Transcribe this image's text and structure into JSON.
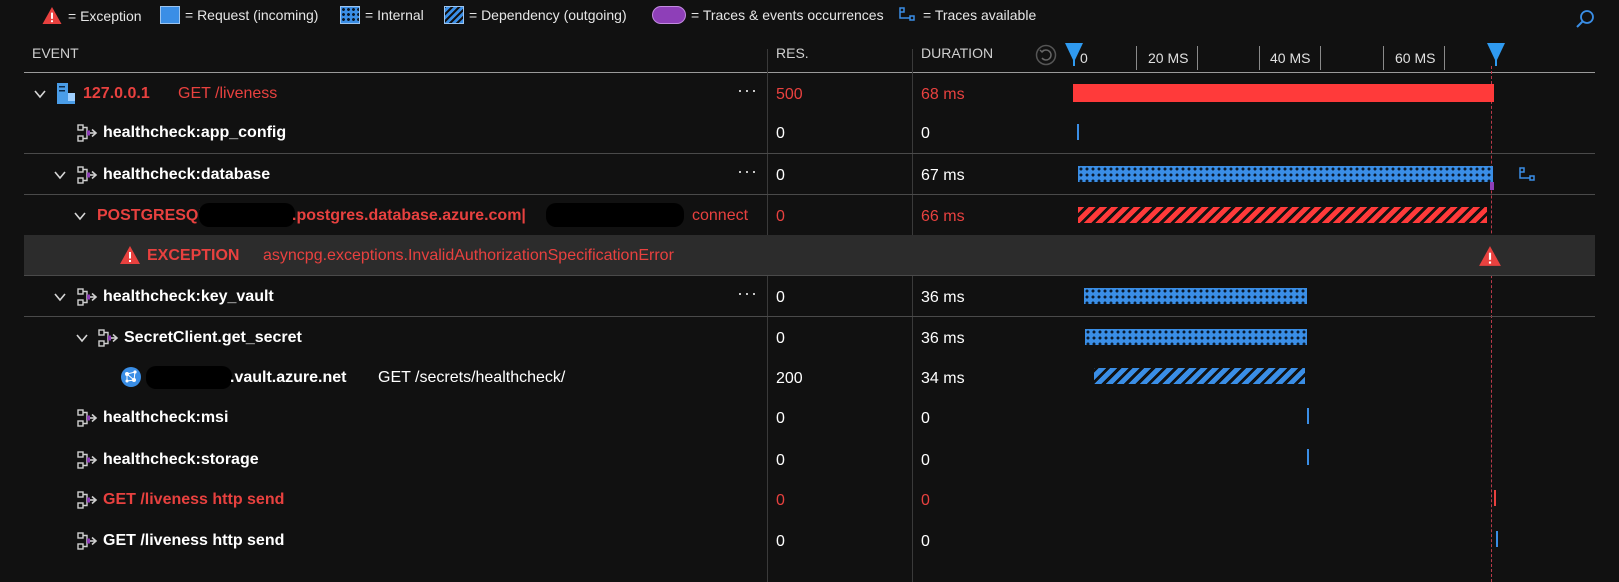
{
  "legend": {
    "exception": "= Exception",
    "request": "= Request (incoming)",
    "internal": "= Internal",
    "dependency": "= Dependency (outgoing)",
    "traces_events": "= Traces & events occurrences",
    "traces_available": "= Traces available"
  },
  "header": {
    "event": "EVENT",
    "res": "RES.",
    "duration": "DURATION",
    "ticks": [
      "0",
      "20 MS",
      "40 MS",
      "60 MS"
    ]
  },
  "colors": {
    "error_red": "#e8413f",
    "request_bar": "#ff3a3a",
    "internal_blue": "#3a8ee6",
    "traces_purple": "#8e3fb8",
    "background": "#111111"
  },
  "rows": [
    {
      "host": "127.0.0.1",
      "label": "GET /liveness",
      "res": "500",
      "duration": "68 ms",
      "kind": "request"
    },
    {
      "label": "healthcheck:app_config",
      "res": "0",
      "duration": "0"
    },
    {
      "label": "healthcheck:database",
      "res": "0",
      "duration": "67 ms"
    },
    {
      "prefix": "POSTGRESQL",
      "label": ".postgres.database.azure.com|",
      "op": "connect",
      "res": "0",
      "duration": "66 ms"
    },
    {
      "label": "EXCEPTION",
      "detail": "asyncpg.exceptions.InvalidAuthorizationSpecificationError"
    },
    {
      "label": "healthcheck:key_vault",
      "res": "0",
      "duration": "36 ms"
    },
    {
      "label": "SecretClient.get_secret",
      "res": "0",
      "duration": "36 ms"
    },
    {
      "label": ".vault.azure.net",
      "op": "GET /secrets/healthcheck/",
      "res": "200",
      "duration": "34 ms"
    },
    {
      "label": "healthcheck:msi",
      "res": "0",
      "duration": "0"
    },
    {
      "label": "healthcheck:storage",
      "res": "0",
      "duration": "0"
    },
    {
      "label": "GET /liveness http send",
      "res": "0",
      "duration": "0"
    },
    {
      "label": "GET /liveness http send",
      "res": "0",
      "duration": "0"
    }
  ],
  "icons": {
    "exception": "warning-triangle-icon",
    "request": "server-icon",
    "internal": "component-icon",
    "trace": "trace-tree-icon",
    "search": "search-icon",
    "reset": "reset-icon",
    "cursor": "timeline-cursor-icon",
    "azure": "azure-globe-icon"
  }
}
